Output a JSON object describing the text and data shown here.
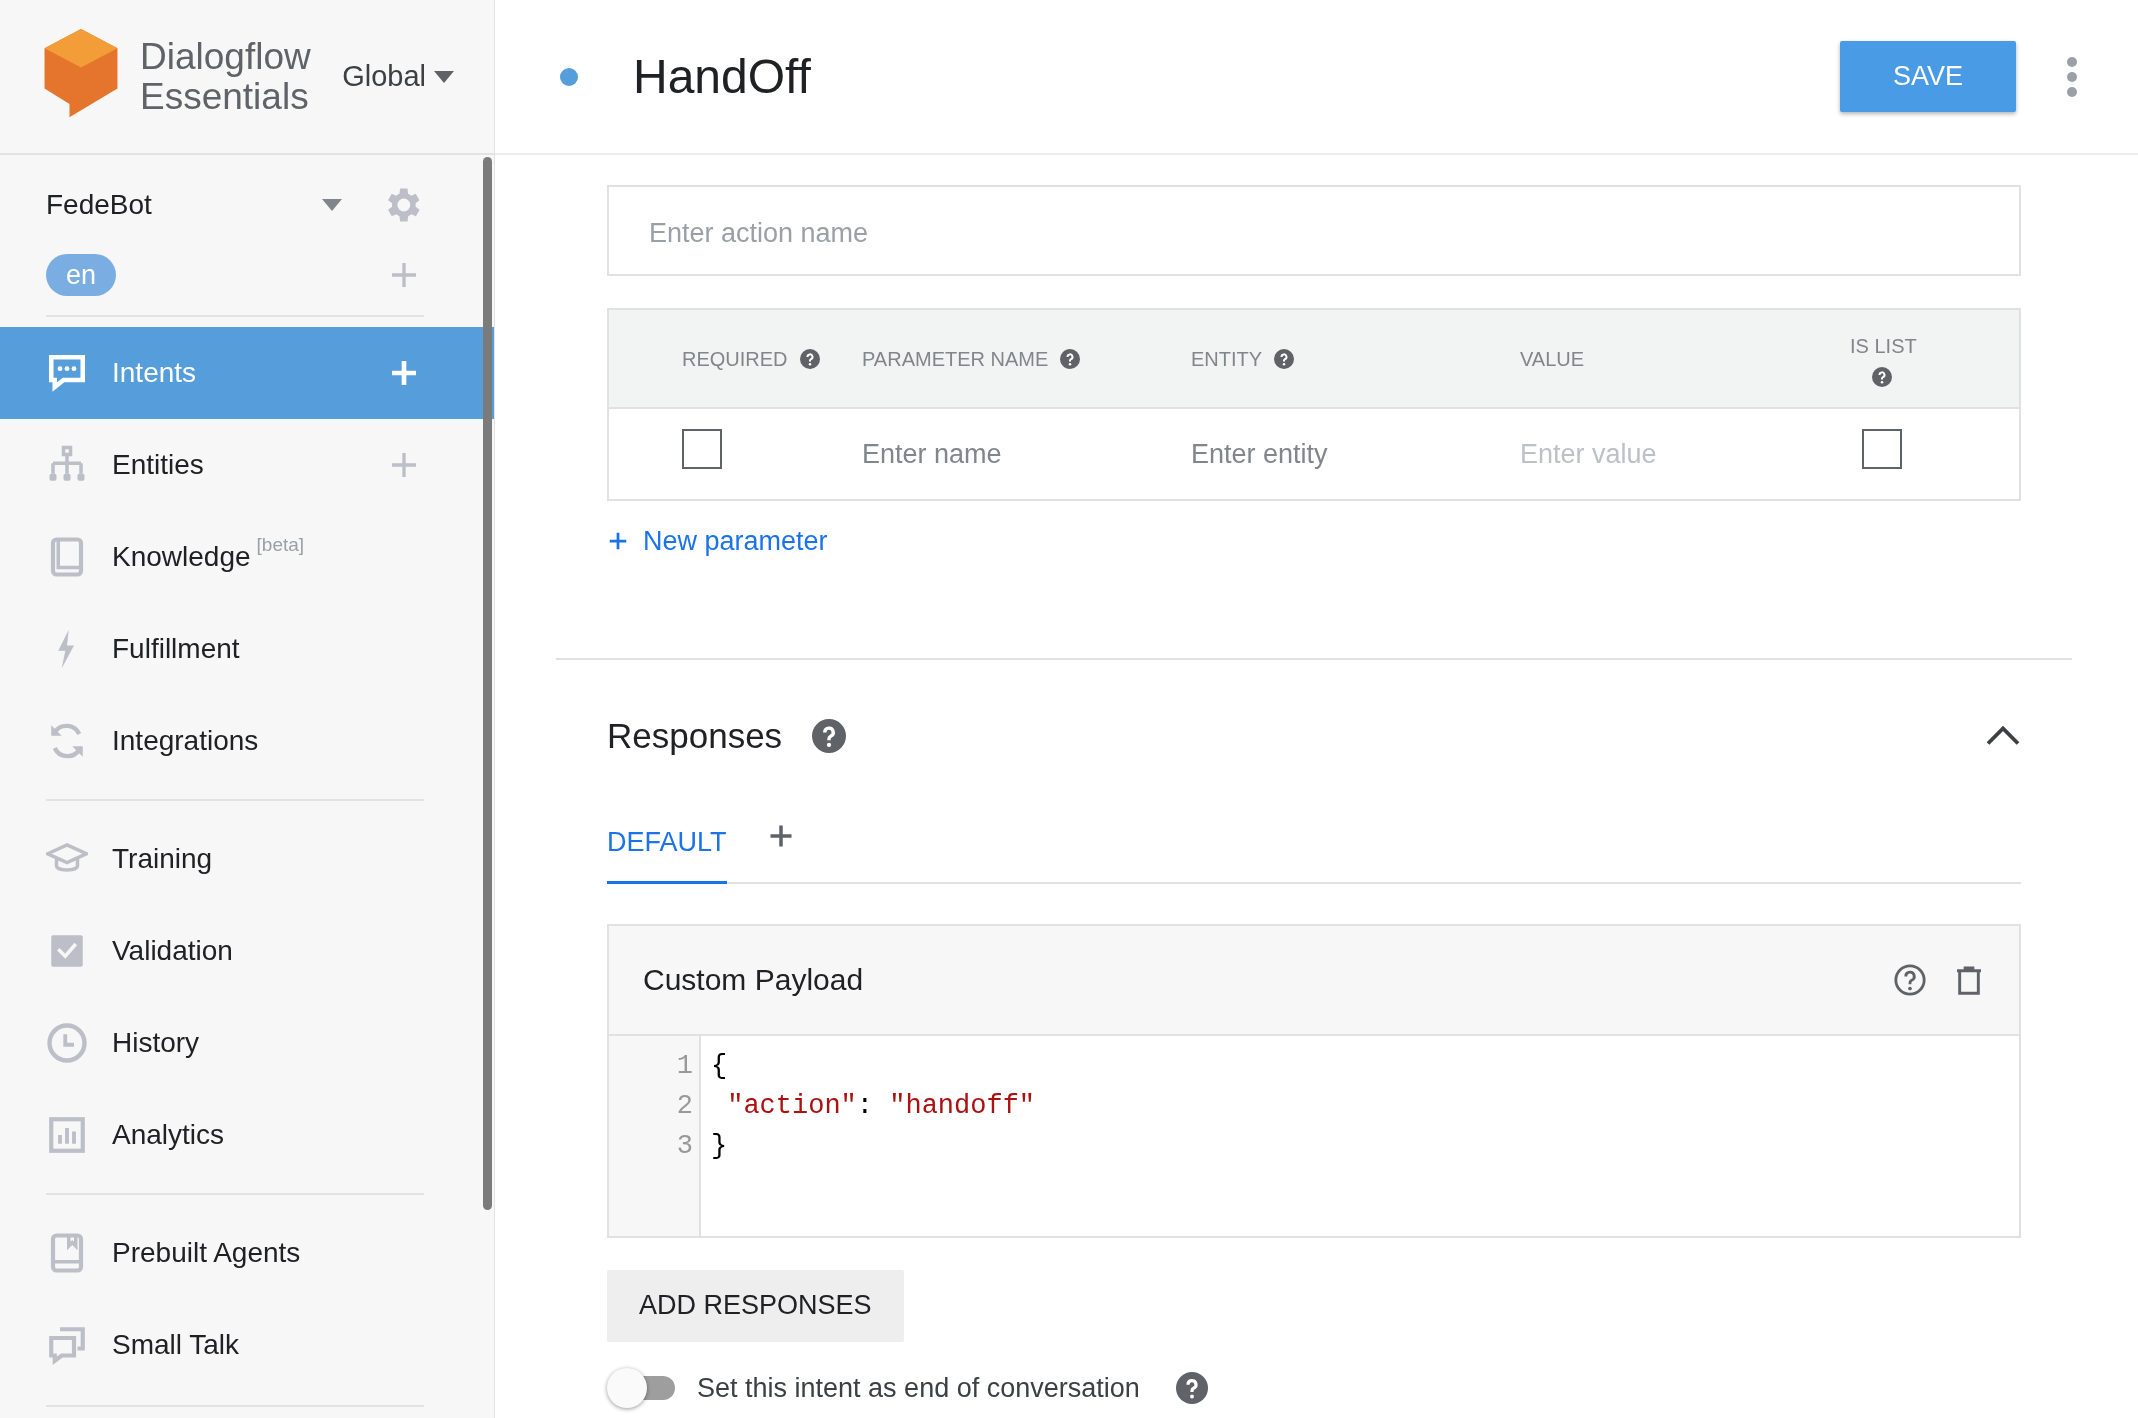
{
  "brand": {
    "line_1": "Dialogflow",
    "line_2": "Essentials",
    "region": "Global"
  },
  "agent": {
    "name": "FedeBot",
    "language": "en"
  },
  "sidebar": {
    "groups": [
      [
        {
          "label": "Intents",
          "selected": true,
          "addable": true
        },
        {
          "label": "Entities",
          "selected": false,
          "addable": true
        },
        {
          "label": "Knowledge",
          "tag": "[beta]",
          "selected": false,
          "addable": false
        },
        {
          "label": "Fulfillment",
          "selected": false,
          "addable": false
        },
        {
          "label": "Integrations",
          "selected": false,
          "addable": false
        }
      ],
      [
        {
          "label": "Training",
          "selected": false,
          "addable": false
        },
        {
          "label": "Validation",
          "selected": false,
          "addable": false
        },
        {
          "label": "History",
          "selected": false,
          "addable": false
        },
        {
          "label": "Analytics",
          "selected": false,
          "addable": false
        }
      ],
      [
        {
          "label": "Prebuilt Agents",
          "selected": false,
          "addable": false
        },
        {
          "label": "Small Talk",
          "selected": false,
          "addable": false
        }
      ]
    ]
  },
  "header": {
    "title": "HandOff",
    "save": "SAVE"
  },
  "action": {
    "placeholder": "Enter action name"
  },
  "parameters": {
    "columns": [
      {
        "label": "REQUIRED",
        "help": true
      },
      {
        "label": "PARAMETER NAME",
        "help": true
      },
      {
        "label": "ENTITY",
        "help": true
      },
      {
        "label": "VALUE",
        "help": false
      },
      {
        "label": "IS LIST",
        "help": true
      }
    ],
    "row": {
      "required": false,
      "name_placeholder": "Enter name",
      "entity_placeholder": "Enter entity",
      "value_placeholder": "Enter value",
      "is_list": false
    },
    "add": "New parameter"
  },
  "responses": {
    "title": "Responses",
    "expanded": true,
    "tabs": [
      {
        "label": "DEFAULT",
        "selected": true
      }
    ],
    "card": {
      "title": "Custom Payload",
      "code": [
        [
          {
            "kind": "punct",
            "text": "{"
          }
        ],
        [
          {
            "kind": "string",
            "text": " \"action\""
          },
          {
            "kind": "punct",
            "text": ": "
          },
          {
            "kind": "string",
            "text": "\"handoff\""
          }
        ],
        [
          {
            "kind": "punct",
            "text": "}"
          }
        ]
      ],
      "line_numbers": [
        "1",
        "2",
        "3"
      ]
    },
    "add_button": "ADD RESPONSES",
    "end_toggle": {
      "label": "Set this intent as end of conversation",
      "on": false
    }
  }
}
